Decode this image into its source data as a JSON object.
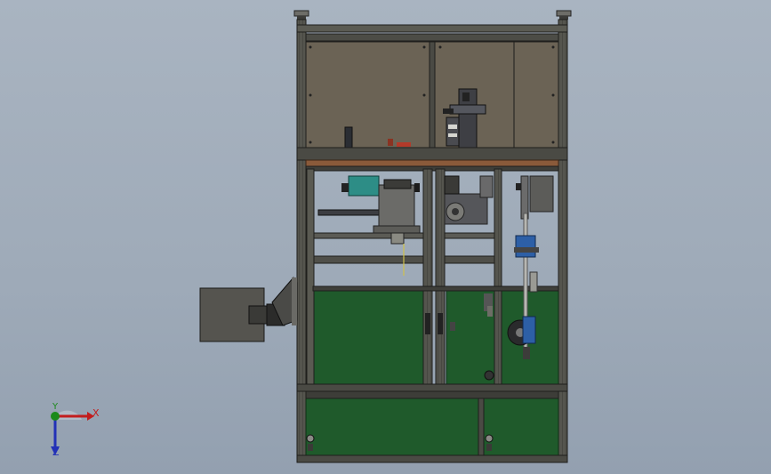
{
  "viewport": {
    "background_top": "#a9b4c1",
    "background_bottom": "#93a0b0"
  },
  "colors": {
    "frame": "#4e4e47",
    "frame_edge": "#1e1e1c",
    "upper_panel": "#6b6355",
    "green_panel": "#1f5a2b",
    "wood_rail": "#8a5a3a",
    "teal_part": "#2d8d86",
    "blue_part": "#2d5fa6",
    "red_part": "#b23a2a"
  },
  "triad": {
    "x_label": "X",
    "y_label": "Y",
    "z_label": "Z",
    "x_color": "#c21d1d",
    "y_color": "#1b8a1b",
    "z_color": "#2231b7"
  }
}
